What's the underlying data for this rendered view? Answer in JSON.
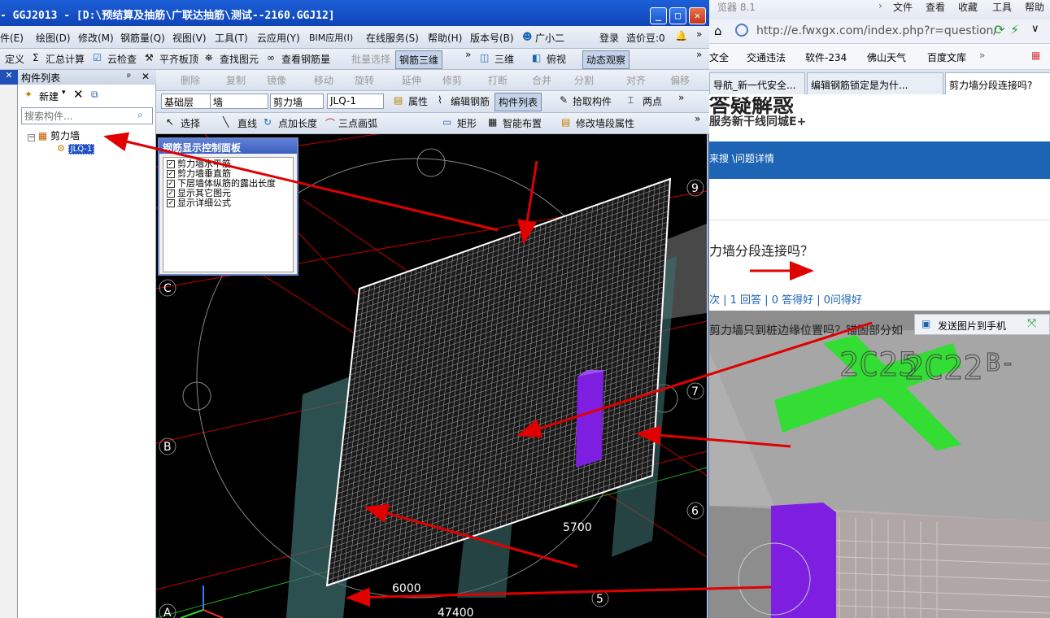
{
  "browser": {
    "title_fragment": "览器 8.1",
    "menu": [
      "文件",
      "查看",
      "收藏",
      "工具",
      "帮助"
    ],
    "address": "http://e.fwxgx.com/index.php?r=question/",
    "favorites": [
      "文全",
      "交通违法",
      "软件-234",
      "佛山天气",
      "百度文库"
    ],
    "tabs": [
      "导航_新一代安全...",
      "编辑钢筋锁定是为什...",
      "剪力墙分段连接吗?"
    ],
    "page": {
      "heading_fragment": "答疑解惑",
      "subheading": "服务新干线同城E+",
      "nav_link": "来搜 \\问题详情",
      "question_title": "力墙分段连接吗？",
      "stats": "次 | 1 回答 | 0 答得好 | 0问得好",
      "body_text": "剪力墙只到桩边缘位置吗？锚固部分如",
      "send_button": "发送图片到手机"
    }
  },
  "app": {
    "title": "- GGJ2013 - [D:\\预结算及抽筋\\广联达抽筋\\测试--2160.GGJ12]",
    "menu": [
      "件(E)",
      "绘图(D)",
      "修改(M)",
      "钢筋量(Q)",
      "视图(V)",
      "工具(T)",
      "云应用(Y)",
      "BIM应用(I)",
      "在线服务(S)",
      "帮助(H)",
      "版本号(B)",
      "广小二",
      "登录",
      "造价豆:0"
    ],
    "toolbar1": [
      "定义",
      "汇总计算",
      "云检查",
      "平齐板顶",
      "查找图元",
      "查看钢筋量",
      "批量选择",
      "钢筋三维",
      "三维",
      "俯视",
      "动态观察"
    ],
    "toolbar2": [
      "删除",
      "复制",
      "镜像",
      "移动",
      "旋转",
      "延伸",
      "修剪",
      "打断",
      "合并",
      "分割",
      "对齐",
      "偏移"
    ],
    "toolbar3": {
      "floor": "基础层",
      "category": "墙",
      "type": "剪力墙",
      "name": "JLQ-1",
      "buttons": [
        "属性",
        "编辑钢筋",
        "构件列表",
        "拾取构件",
        "两点"
      ]
    },
    "toolbar4": [
      "选择",
      "直线",
      "点加长度",
      "三点画弧",
      "矩形",
      "智能布置",
      "修改墙段属性"
    ],
    "side": {
      "header": "构件列表",
      "new_button": "新建",
      "search_placeholder": "搜索构件...",
      "tree_root": "剪力墙",
      "tree_child": "JLQ-1"
    },
    "control_panel": {
      "title": "钢筋显示控制面板",
      "items": [
        "剪力墙水平筋",
        "剪力墙垂直筋",
        "下层墙体纵筋的露出长度",
        "显示其它图元",
        "显示详细公式"
      ]
    },
    "viewport": {
      "axis_labels": [
        "9",
        "C",
        "B",
        "A",
        "7",
        "6",
        "5"
      ],
      "dimensions": [
        "5700",
        "6000",
        "47400"
      ]
    }
  },
  "overlay": {
    "cad_text": [
      "2C25",
      "2C22",
      "B-"
    ]
  },
  "colors": {
    "titlebar": "#0f45b8",
    "arrow": "#e00000",
    "grid": "#c00000",
    "column": "#6b1ad8"
  }
}
